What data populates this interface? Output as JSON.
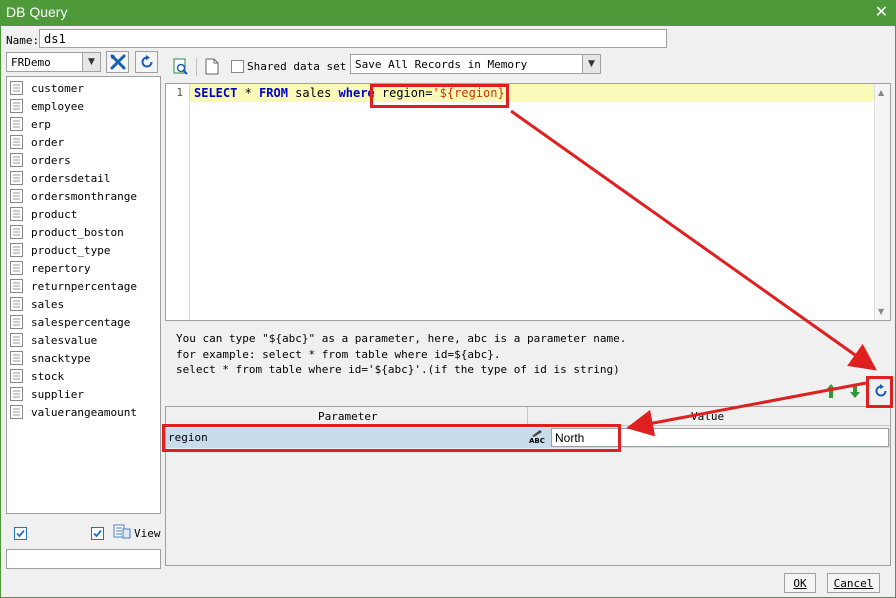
{
  "window": {
    "title": "DB Query"
  },
  "name": {
    "label": "Name:",
    "value": "ds1"
  },
  "connection": {
    "value": "FRDemo"
  },
  "tables": [
    "customer",
    "employee",
    "erp",
    "order",
    "orders",
    "ordersdetail",
    "ordersmonthrange",
    "product",
    "product_boston",
    "product_type",
    "repertory",
    "returnpercentage",
    "sales",
    "salespercentage",
    "salesvalue",
    "snacktype",
    "stock",
    "supplier",
    "valuerangeamount"
  ],
  "bottom_left": {
    "view_label": "View"
  },
  "toolbar": {
    "shared_label": "Shared data set",
    "memory_option": "Save All Records in Memory"
  },
  "editor": {
    "line_number": "1",
    "kw_select": "SELECT",
    "star": " * ",
    "kw_from": "FROM",
    "table": " sales ",
    "kw_where": "where",
    "condition": " region=",
    "param_literal": "'${region}'"
  },
  "hint": {
    "line1": "You can type \"${abc}\" as a parameter, here, abc is a parameter name.",
    "line2": "for example: select * from table where id=${abc}.",
    "line3": "select * from table where id='${abc}'.(if the type of id is string)"
  },
  "params": {
    "col_parameter": "Parameter",
    "col_value": "Value",
    "row_name": "region",
    "row_value": "North",
    "type_icon_text": "ABC"
  },
  "buttons": {
    "ok": "OK",
    "cancel": "Cancel"
  },
  "colors": {
    "titlebar": "#4e9a3a",
    "highlight": "#e02020",
    "keyword": "#0000cc",
    "string": "#cc3300",
    "row_selected": "#c8dcec",
    "current_line": "#fafab8"
  }
}
